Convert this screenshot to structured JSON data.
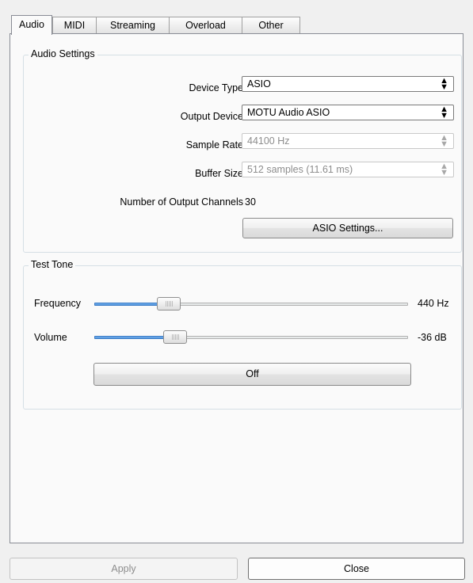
{
  "tabs": [
    {
      "label": "Audio",
      "active": true
    },
    {
      "label": "MIDI",
      "active": false
    },
    {
      "label": "Streaming",
      "active": false
    },
    {
      "label": "Overload",
      "active": false
    },
    {
      "label": "Other",
      "active": false
    }
  ],
  "audio_settings": {
    "title": "Audio Settings",
    "device_type": {
      "label": "Device Type",
      "value": "ASIO"
    },
    "output_device": {
      "label": "Output Device",
      "value": "MOTU Audio ASIO"
    },
    "sample_rate": {
      "label": "Sample Rate",
      "value": "44100 Hz",
      "enabled": false
    },
    "buffer_size": {
      "label": "Buffer Size",
      "value": "512 samples (11.61 ms)",
      "enabled": false
    },
    "output_channels": {
      "label": "Number of Output Channels",
      "value": "30"
    },
    "asio_settings_button": "ASIO Settings..."
  },
  "test_tone": {
    "title": "Test Tone",
    "frequency": {
      "label": "Frequency",
      "value": "440 Hz",
      "position": 0.22
    },
    "volume": {
      "label": "Volume",
      "value": "-36 dB",
      "position": 0.24
    },
    "toggle_button": "Off"
  },
  "footer": {
    "apply_label": "Apply",
    "apply_enabled": false,
    "close_label": "Close"
  },
  "icons": {
    "combo_arrow": "up-down-arrows-icon",
    "slider_grip": "grip-icon"
  }
}
